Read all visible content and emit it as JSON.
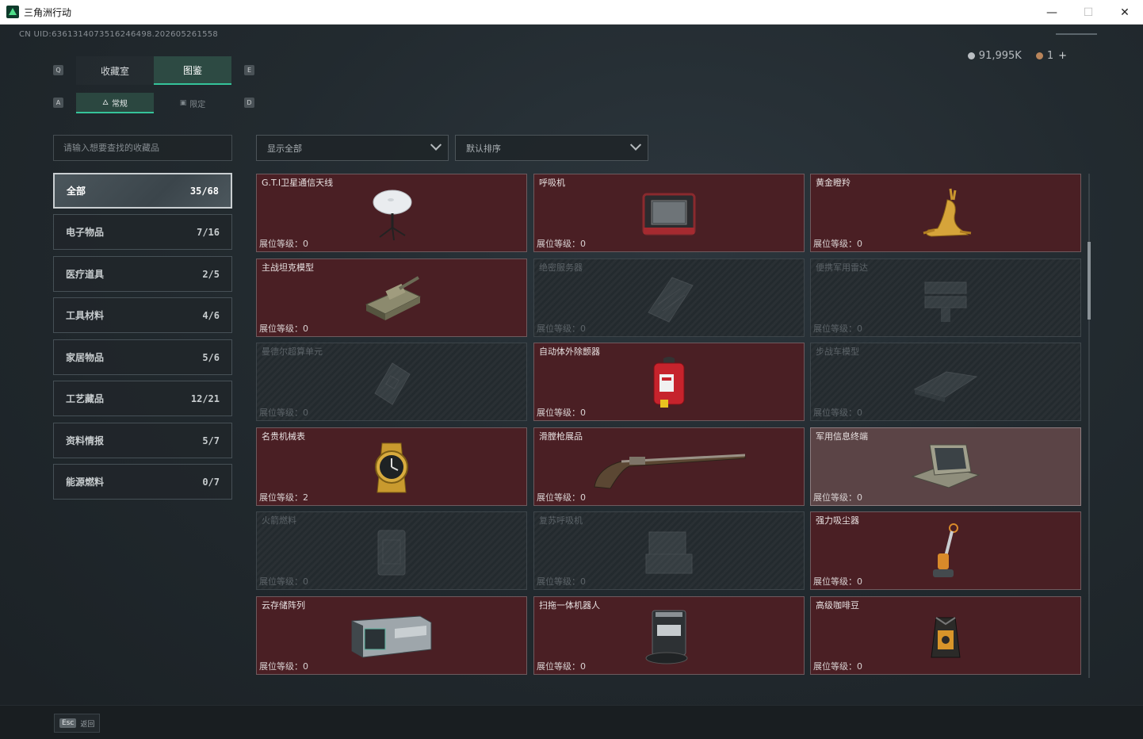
{
  "window": {
    "title": "三角洲行动",
    "minimize": "—",
    "maximize": "☐",
    "close": "✕"
  },
  "header": {
    "uid": "CN UID:6361314073516246498.202605261558",
    "currency1": "91,995K",
    "currency2": "1",
    "add": "+"
  },
  "main_tabs": [
    {
      "label": "收藏室",
      "key": "Q"
    },
    {
      "label": "图鉴",
      "key": "E"
    }
  ],
  "sub_tabs": [
    {
      "label": "常规",
      "key": "A"
    },
    {
      "label": "限定",
      "key": "D"
    }
  ],
  "search": {
    "placeholder": "请输入想要查找的收藏品"
  },
  "filters": {
    "show": "显示全部",
    "sort": "默认排序"
  },
  "categories": [
    {
      "label": "全部",
      "count": "35/68"
    },
    {
      "label": "电子物品",
      "count": "7/16"
    },
    {
      "label": "医疗道具",
      "count": "2/5"
    },
    {
      "label": "工具材料",
      "count": "4/6"
    },
    {
      "label": "家居物品",
      "count": "5/6"
    },
    {
      "label": "工艺藏品",
      "count": "12/21"
    },
    {
      "label": "资料情报",
      "count": "5/7"
    },
    {
      "label": "能源燃料",
      "count": "0/7"
    }
  ],
  "level_prefix": "展位等级：",
  "items": [
    {
      "name": "G.T.I卫星通信天线",
      "level": "0",
      "icon": "satellite-dish-icon"
    },
    {
      "name": "呼吸机",
      "level": "0",
      "icon": "ventilator-icon"
    },
    {
      "name": "黄金瞪羚",
      "level": "0",
      "icon": "golden-gazelle-icon"
    },
    {
      "name": "主战坦克模型",
      "level": "0",
      "icon": "tank-model-icon"
    },
    {
      "name": "绝密服务器",
      "level": "0",
      "icon": "server-icon"
    },
    {
      "name": "便携军用雷达",
      "level": "0",
      "icon": "radar-icon"
    },
    {
      "name": "曼德尔超算单元",
      "level": "0",
      "icon": "supercomputer-icon"
    },
    {
      "name": "自动体外除颤器",
      "level": "0",
      "icon": "defibrillator-icon"
    },
    {
      "name": "步战车模型",
      "level": "0",
      "icon": "ifv-model-icon"
    },
    {
      "name": "名贵机械表",
      "level": "2",
      "icon": "watch-icon"
    },
    {
      "name": "滑膛枪展品",
      "level": "0",
      "icon": "musket-icon"
    },
    {
      "name": "军用信息终端",
      "level": "0",
      "icon": "terminal-icon"
    },
    {
      "name": "火箭燃料",
      "level": "0",
      "icon": "rocket-fuel-icon"
    },
    {
      "name": "复苏呼吸机",
      "level": "0",
      "icon": "resuscitator-icon"
    },
    {
      "name": "强力吸尘器",
      "level": "0",
      "icon": "vacuum-icon"
    },
    {
      "name": "云存储阵列",
      "level": "0",
      "icon": "storage-array-icon"
    },
    {
      "name": "扫拖一体机器人",
      "level": "0",
      "icon": "robot-vacuum-icon"
    },
    {
      "name": "高级咖啡豆",
      "level": "0",
      "icon": "coffee-beans-icon"
    }
  ],
  "footer": {
    "esc_key": "Esc",
    "back": "返回"
  }
}
